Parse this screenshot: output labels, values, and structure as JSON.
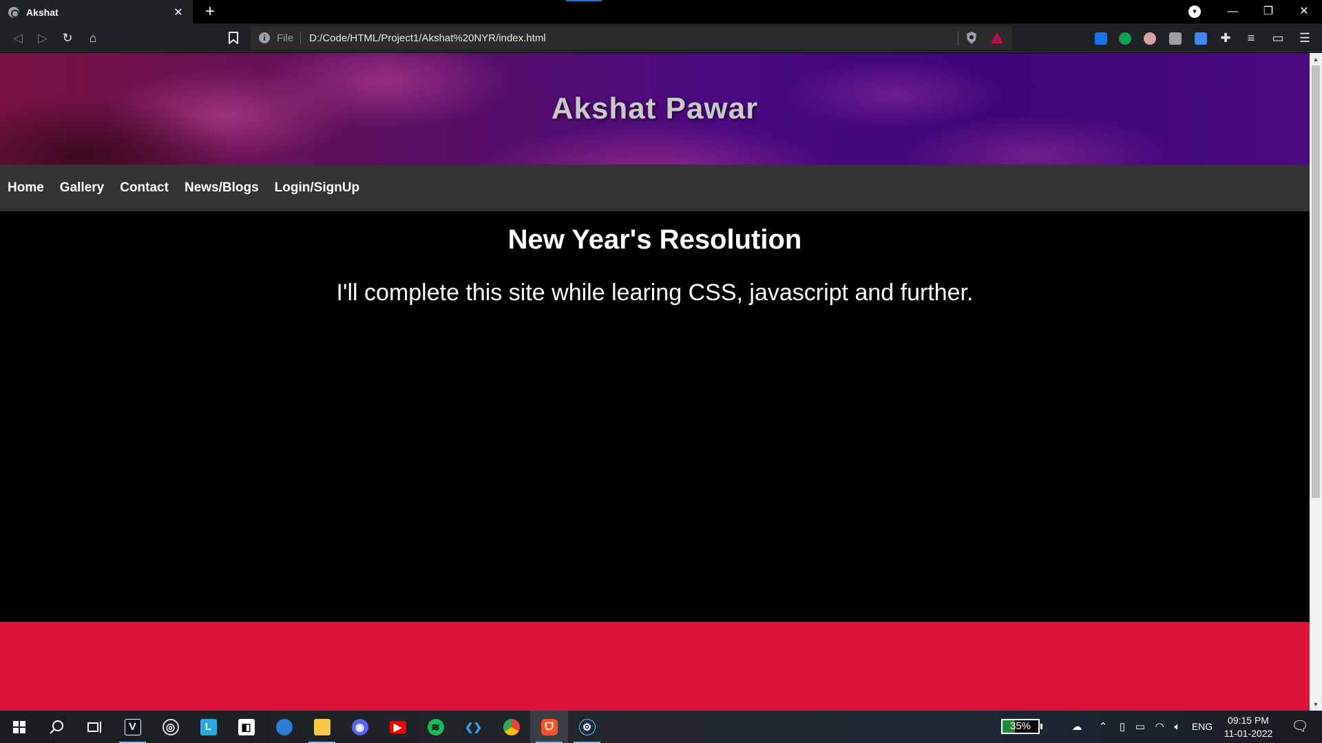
{
  "browser": {
    "tab_title": "Akshat",
    "tab_close": "✕",
    "new_tab": "+",
    "url_scheme": "File",
    "url": "D:/Code/HTML/Project1/Akshat%20NYR/index.html",
    "window_controls": {
      "minimize": "—",
      "restore": "❐",
      "close": "✕"
    }
  },
  "page": {
    "banner_title": "Akshat Pawar",
    "nav": [
      "Home",
      "Gallery",
      "Contact",
      "News/Blogs",
      "Login/SignUp"
    ],
    "heading": "New Year's Resolution",
    "text": "I'll complete this site while learing CSS, javascript and further.",
    "colors": {
      "navbar": "#333333",
      "footer": "#dc143c",
      "background": "#000000"
    }
  },
  "taskbar": {
    "battery_percent": "35%",
    "battery_level": 0.35,
    "language": "ENG",
    "time": "09:15 PM",
    "date": "11-01-2022",
    "apps": [
      "start-icon",
      "search-icon",
      "task-view-icon",
      "valorant-icon",
      "obs-icon",
      "lightshot-icon",
      "dolby-icon",
      "firefox-icon",
      "file-explorer-icon",
      "discord-icon",
      "youtube-icon",
      "spotify-icon",
      "vscode-icon",
      "chrome-icon",
      "brave-icon",
      "steam-icon"
    ]
  }
}
